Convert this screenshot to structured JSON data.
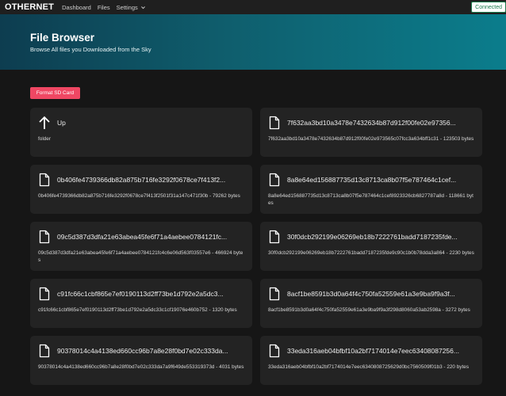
{
  "navbar": {
    "brand": "OTHERNET",
    "links": [
      {
        "label": "Dashboard"
      },
      {
        "label": "Files"
      },
      {
        "label": "Settings"
      }
    ],
    "status": "Connected"
  },
  "header": {
    "title": "File Browser",
    "subtitle": "Browse All files you Downloaded from the Sky"
  },
  "actions": {
    "format_label": "Format SD Card"
  },
  "files": [
    {
      "icon": "arrow-up-icon",
      "name": "Up",
      "detail": "folder"
    },
    {
      "icon": "file-icon",
      "name": "7f632aa3bd10a3478e7432634b87d912f00fe02e97356...",
      "detail": "7f632aa3bd10a3478e7432634b87d912f00fe02e973565c07fcc3a634bff1c31 - 123503 bytes"
    },
    {
      "icon": "file-icon",
      "name": "0b406fe4739366db82a875b716fe3292f0678ce7f413f2...",
      "detail": "0b406fe4739366db82a875b716fe3292f0678ce7f413f2501f31a147c471f30b - 79262 bytes"
    },
    {
      "icon": "file-icon",
      "name": "8a8e64ed156887735d13c8713ca8b07f5e787464c1cef...",
      "detail": "8a8e64ed156887735d13c8713ca8b07f5e787464c1cef8923326cb6827787a8d - 118661 bytes"
    },
    {
      "icon": "file-icon",
      "name": "09c5d387d3dfa21e63abea45fe6f71a4aebee0784121fc...",
      "detail": "09c5d387d3dfa21e63abea45fe6f71a4aebee0784121fc4c6e06d563f03557e6 - 466924 bytes"
    },
    {
      "icon": "file-icon",
      "name": "30f0dcb292199e06269eb18b7222761badd7187235fde...",
      "detail": "30f0dcb292199e06269eb18b7222761badd7187235fde9c90c1b0b78dda3a864 - 2230 bytes"
    },
    {
      "icon": "file-icon",
      "name": "c91fc66c1cbf865e7ef0190113d2ff73be1d792e2a5dc3...",
      "detail": "c91fc66c1cbf865e7ef0190113d2ff73be1d792e2a5dc33c1cf19076e460b752 - 1320 bytes"
    },
    {
      "icon": "file-icon",
      "name": "8acf1be8591b3d0a64f4c750fa52559e61a3e9ba9f9a3f...",
      "detail": "8acf1be8591b3d0a64f4c750fa52559e61a3e9ba9f9a3f298d8060a53ab2598a - 3272 bytes"
    },
    {
      "icon": "file-icon",
      "name": "90378014c4a4138ed660cc96b7a8e28f0bd7e02c333da...",
      "detail": "90378014c4a4138ed660cc96b7a8e28f0bd7e02c333da7a9f649de553319373d - 4031 bytes"
    },
    {
      "icon": "file-icon",
      "name": "33eda316aeb04bfbf10a2bf7174014e7eec63408087256...",
      "detail": "33eda316aeb04bfbf10a2bf7174014e7eec6340808725629d0bc7560509f01b3 - 220 bytes"
    }
  ]
}
